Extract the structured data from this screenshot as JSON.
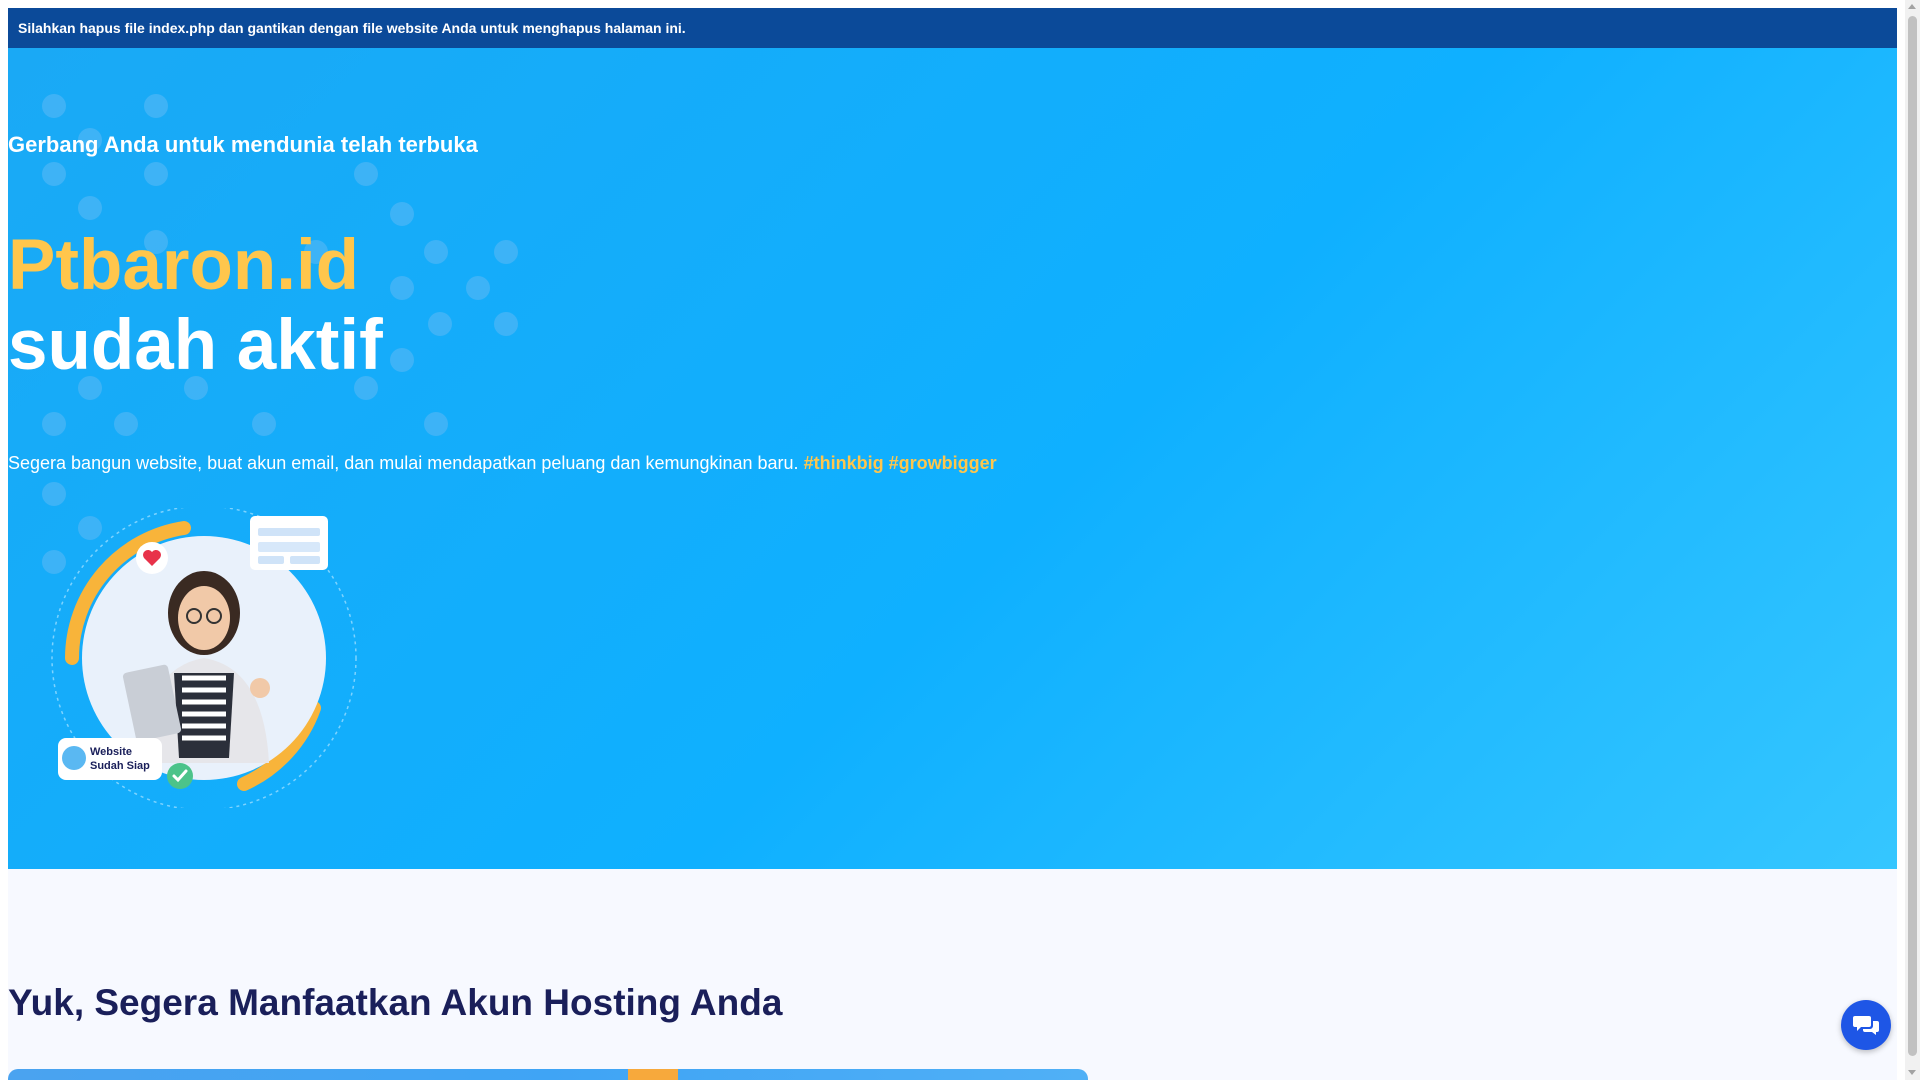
{
  "notice": {
    "text": "Silahkan hapus file index.php dan gantikan dengan file website Anda untuk menghapus halaman ini."
  },
  "hero": {
    "kicker": "Gerbang Anda untuk mendunia telah terbuka",
    "domain": "Ptbaron.id",
    "status": "sudah aktif",
    "description": "Segera bangun website, buat akun email, dan mulai mendapatkan peluang dan kemungkinan baru.",
    "tags": "#thinkbig #growbigger",
    "illustration_badge_line1": "Website",
    "illustration_badge_line2": "Sudah Siap"
  },
  "section": {
    "title": "Yuk, Segera Manfaatkan Akun Hosting Anda"
  },
  "chat": {
    "icon": "chat-bubbles-icon"
  },
  "colors": {
    "notice_bg": "#0b4a99",
    "hero_bg": "#1aa9f5",
    "accent_yellow": "#ffc64c",
    "section_title": "#1a1f5a",
    "chat_button": "#1e56e6"
  }
}
